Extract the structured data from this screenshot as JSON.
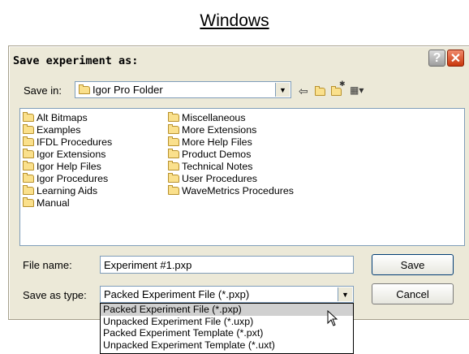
{
  "heading": "Windows",
  "dialog": {
    "title": "Save experiment as:",
    "help_glyph": "?",
    "close_glyph": "✕"
  },
  "save_in": {
    "label": "Save in:",
    "folder": "Igor Pro Folder"
  },
  "toolbar_icons": [
    "back-arrow-icon",
    "up-folder-icon",
    "new-folder-icon",
    "view-menu-icon"
  ],
  "folders": {
    "col1": [
      "Alt Bitmaps",
      "Examples",
      "IFDL Procedures",
      "Igor Extensions",
      "Igor Help Files",
      "Igor Procedures",
      "Learning Aids",
      "Manual"
    ],
    "col2": [
      "Miscellaneous",
      "More Extensions",
      "More Help Files",
      "Product Demos",
      "Technical Notes",
      "User Procedures",
      "WaveMetrics Procedures"
    ]
  },
  "file_name": {
    "label": "File name:",
    "value": "Experiment #1.pxp"
  },
  "save_type": {
    "label": "Save as type:",
    "value": "Packed Experiment File (*.pxp)",
    "options": [
      "Packed Experiment File (*.pxp)",
      "Unpacked Experiment File (*.uxp)",
      "Packed Experiment Template (*.pxt)",
      "Unpacked Experiment Template (*.uxt)"
    ]
  },
  "buttons": {
    "save": "Save",
    "cancel": "Cancel"
  }
}
